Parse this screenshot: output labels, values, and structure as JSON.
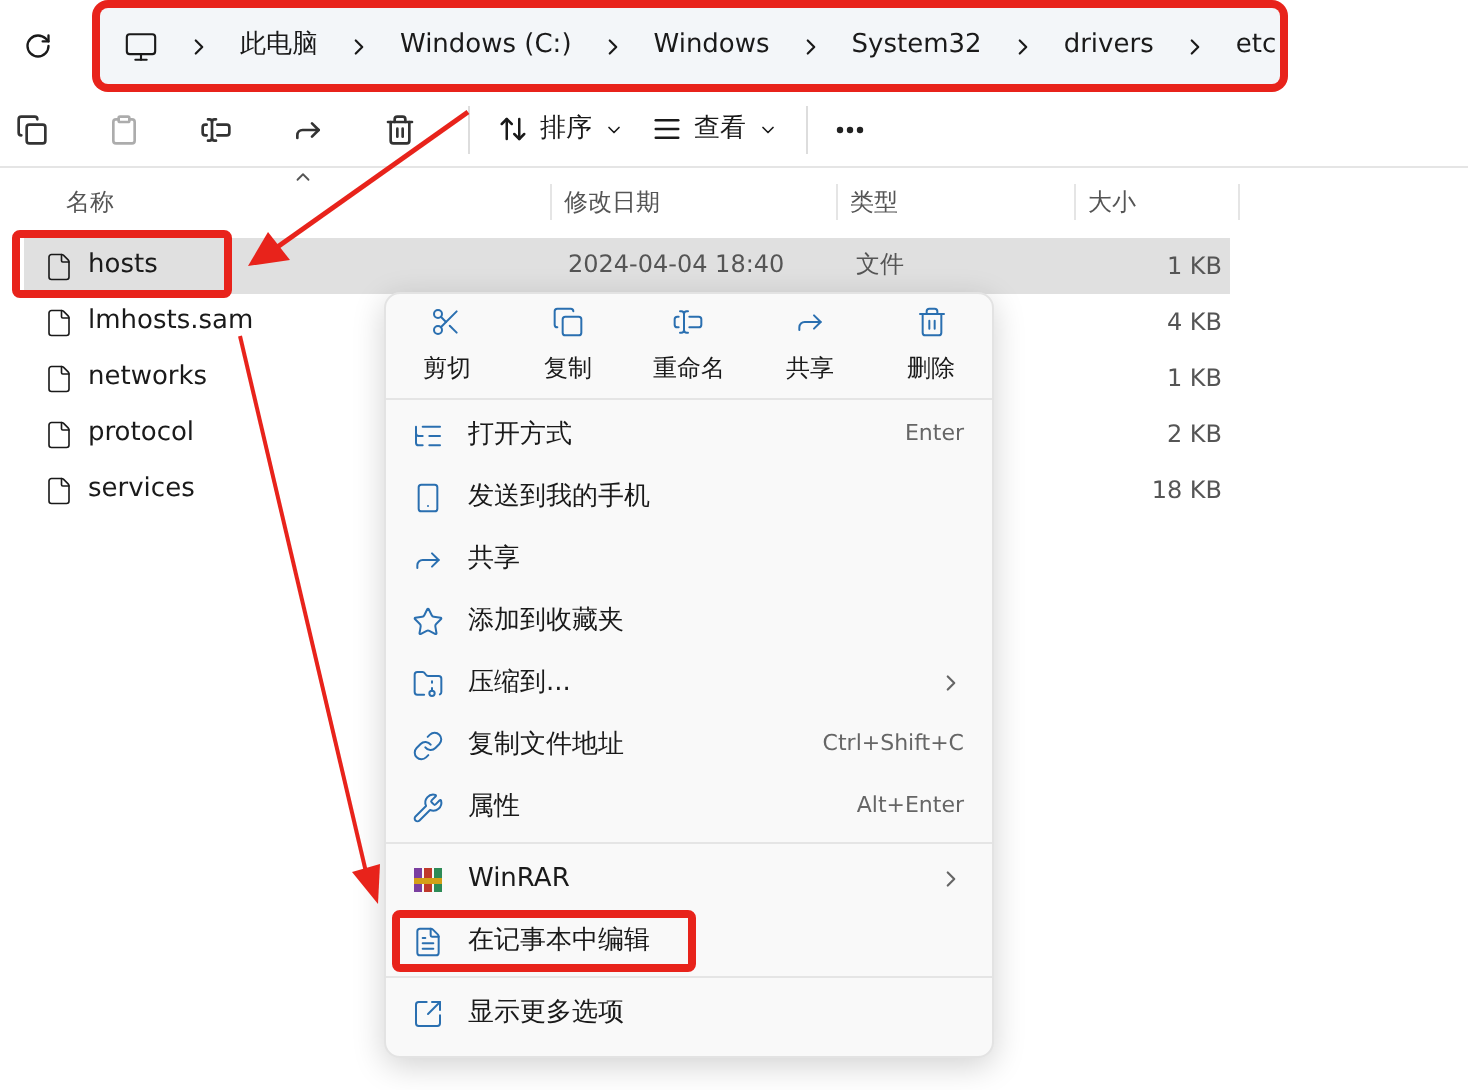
{
  "address_bar": {
    "highlighted": true,
    "crumbs": [
      "此电脑",
      "Windows (C:)",
      "Windows",
      "System32",
      "drivers",
      "etc"
    ]
  },
  "toolbar": {
    "sort": "排序",
    "view": "查看"
  },
  "columns": [
    "名称",
    "修改日期",
    "类型",
    "大小"
  ],
  "files": [
    {
      "name": "hosts",
      "date": "2024-04-04 18:40",
      "type": "文件",
      "size": "1 KB",
      "selected": true,
      "highlighted": true
    },
    {
      "name": "lmhosts.sam",
      "size": "4 KB",
      "selected": false,
      "highlighted": false
    },
    {
      "name": "networks",
      "size": "1 KB",
      "selected": false,
      "highlighted": false
    },
    {
      "name": "protocol",
      "size": "2 KB",
      "selected": false,
      "highlighted": false
    },
    {
      "name": "services",
      "size": "18 KB",
      "selected": false,
      "highlighted": false
    }
  ],
  "context_menu": {
    "actions": [
      "剪切",
      "复制",
      "重命名",
      "共享",
      "删除"
    ],
    "groups": [
      [
        {
          "label": "打开方式",
          "shortcut": "Enter",
          "submenu": false,
          "highlighted": false
        },
        {
          "label": "发送到我的手机",
          "submenu": false,
          "highlighted": false
        },
        {
          "label": "共享",
          "submenu": false,
          "highlighted": false
        },
        {
          "label": "添加到收藏夹",
          "submenu": false,
          "highlighted": false
        },
        {
          "label": "压缩到...",
          "submenu": true,
          "highlighted": false
        },
        {
          "label": "复制文件地址",
          "shortcut": "Ctrl+Shift+C",
          "submenu": false,
          "highlighted": false
        },
        {
          "label": "属性",
          "shortcut": "Alt+Enter",
          "submenu": false,
          "highlighted": false
        }
      ],
      [
        {
          "label": "WinRAR",
          "submenu": true,
          "highlighted": false
        },
        {
          "label": "在记事本中编辑",
          "submenu": false,
          "highlighted": true
        }
      ],
      [
        {
          "label": "显示更多选项",
          "submenu": false,
          "highlighted": false
        }
      ]
    ]
  }
}
